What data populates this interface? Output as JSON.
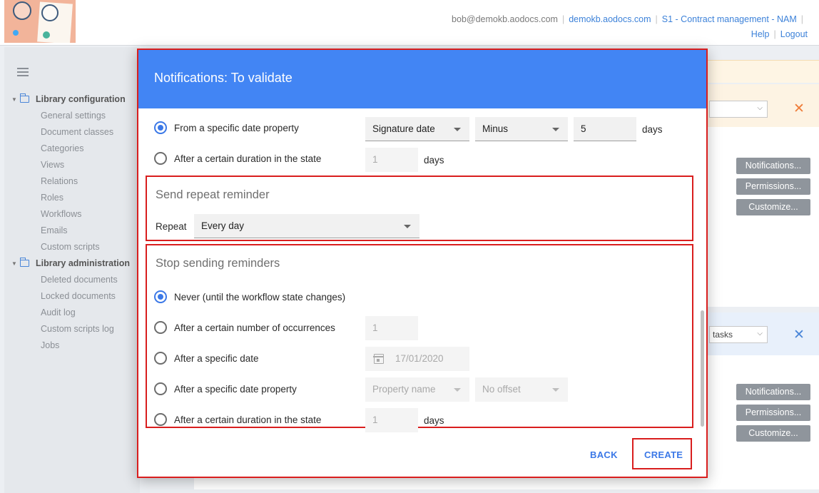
{
  "header": {
    "user": "bob@demokb.aodocs.com",
    "domain_link": "demokb.aodocs.com",
    "library_link": "S1 - Contract management - NAM",
    "help": "Help",
    "logout": "Logout",
    "separator": "|"
  },
  "sidebar": {
    "groups": [
      {
        "label": "Library configuration",
        "items": [
          "General settings",
          "Document classes",
          "Categories",
          "Views",
          "Relations",
          "Roles",
          "Workflows",
          "Emails",
          "Custom scripts"
        ]
      },
      {
        "label": "Library administration",
        "items": [
          "Deleted documents",
          "Locked documents",
          "Audit log",
          "Custom scripts log",
          "Jobs"
        ]
      }
    ]
  },
  "background": {
    "card2_select": "tasks",
    "buttons": {
      "notifications": "Notifications...",
      "permissions": "Permissions...",
      "customize": "Customize..."
    },
    "close_glyph": "✕"
  },
  "dialog": {
    "title": "Notifications: To validate",
    "start": {
      "option_date_property": "From a specific date property",
      "property_value": "Signature date",
      "operator_value": "Minus",
      "offset_value": "5",
      "offset_unit": "days",
      "option_duration": "After a certain duration in the state",
      "duration_value": "1",
      "duration_unit": "days"
    },
    "repeat": {
      "title": "Send repeat reminder",
      "label": "Repeat",
      "value": "Every day"
    },
    "stop": {
      "title": "Stop sending reminders",
      "option_never": "Never (until the workflow state changes)",
      "option_occurrences": "After a certain number of occurrences",
      "occurrences_value": "1",
      "option_date": "After a specific date",
      "date_value": "17/01/2020",
      "option_date_property": "After a specific date property",
      "property_placeholder": "Property name",
      "offset_placeholder": "No offset",
      "option_duration": "After a certain duration in the state",
      "duration_value": "1",
      "duration_unit": "days"
    },
    "back": "BACK",
    "create": "CREATE"
  }
}
